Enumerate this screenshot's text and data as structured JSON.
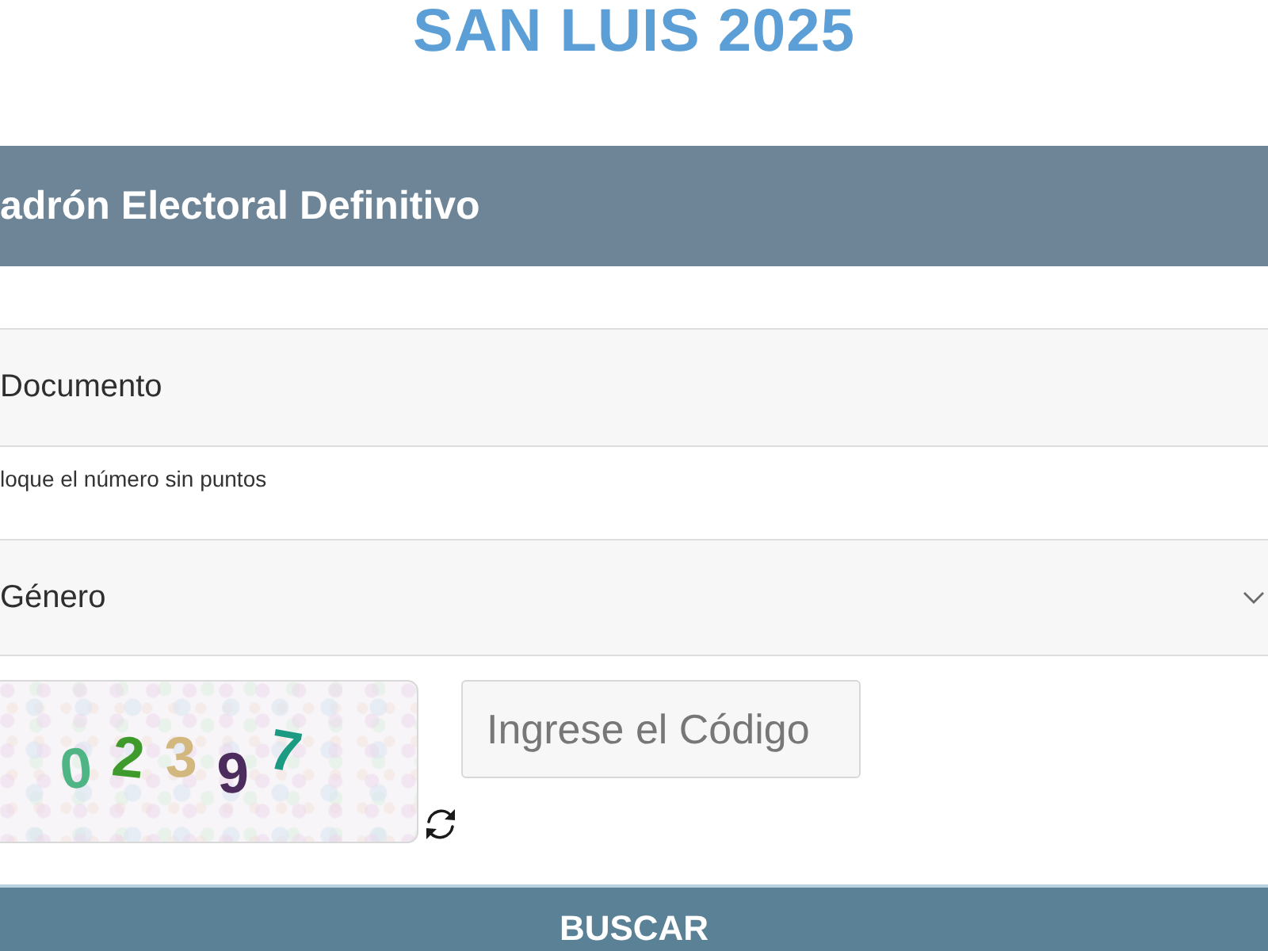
{
  "page": {
    "title": "SAN LUIS 2025"
  },
  "panel": {
    "heading": "adrón Electoral Definitivo"
  },
  "form": {
    "document_field": {
      "placeholder": "Documento"
    },
    "document_help": "loque el número sin puntos",
    "gender_select": {
      "value": "Género"
    },
    "captcha": {
      "digits": [
        {
          "char": "0",
          "color": "#4fb585"
        },
        {
          "char": "2",
          "color": "#3f9a2c"
        },
        {
          "char": "3",
          "color": "#d2b77f"
        },
        {
          "char": "9",
          "color": "#4b2c5c"
        },
        {
          "char": "7",
          "color": "#1c9a82"
        }
      ]
    },
    "code_field": {
      "placeholder": "Ingrese el Código"
    },
    "submit_button": {
      "label": "BUSCAR"
    }
  }
}
